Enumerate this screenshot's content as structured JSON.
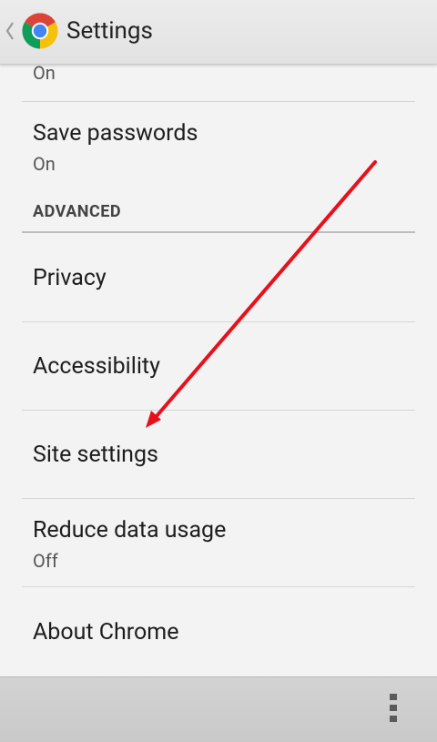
{
  "action_bar": {
    "title": "Settings",
    "up_icon": "chevron-left-icon",
    "app_icon": "chrome-logo-icon"
  },
  "list": {
    "partial_item": {
      "summary": "On"
    },
    "save_passwords": {
      "title": "Save passwords",
      "summary": "On"
    },
    "section_advanced": {
      "header": "ADVANCED"
    },
    "privacy": {
      "title": "Privacy"
    },
    "accessibility": {
      "title": "Accessibility"
    },
    "site_settings": {
      "title": "Site settings"
    },
    "reduce_data_usage": {
      "title": "Reduce data usage",
      "summary": "Off"
    },
    "about_chrome": {
      "title": "About Chrome"
    }
  },
  "bottom_bar": {
    "overflow_icon": "more-vertical-icon"
  },
  "colors": {
    "annotation_arrow": "#e8101a",
    "chrome_red": "#db4437",
    "chrome_yellow": "#f4c20d",
    "chrome_green": "#0f9d58",
    "chrome_blue": "#4285f4"
  }
}
